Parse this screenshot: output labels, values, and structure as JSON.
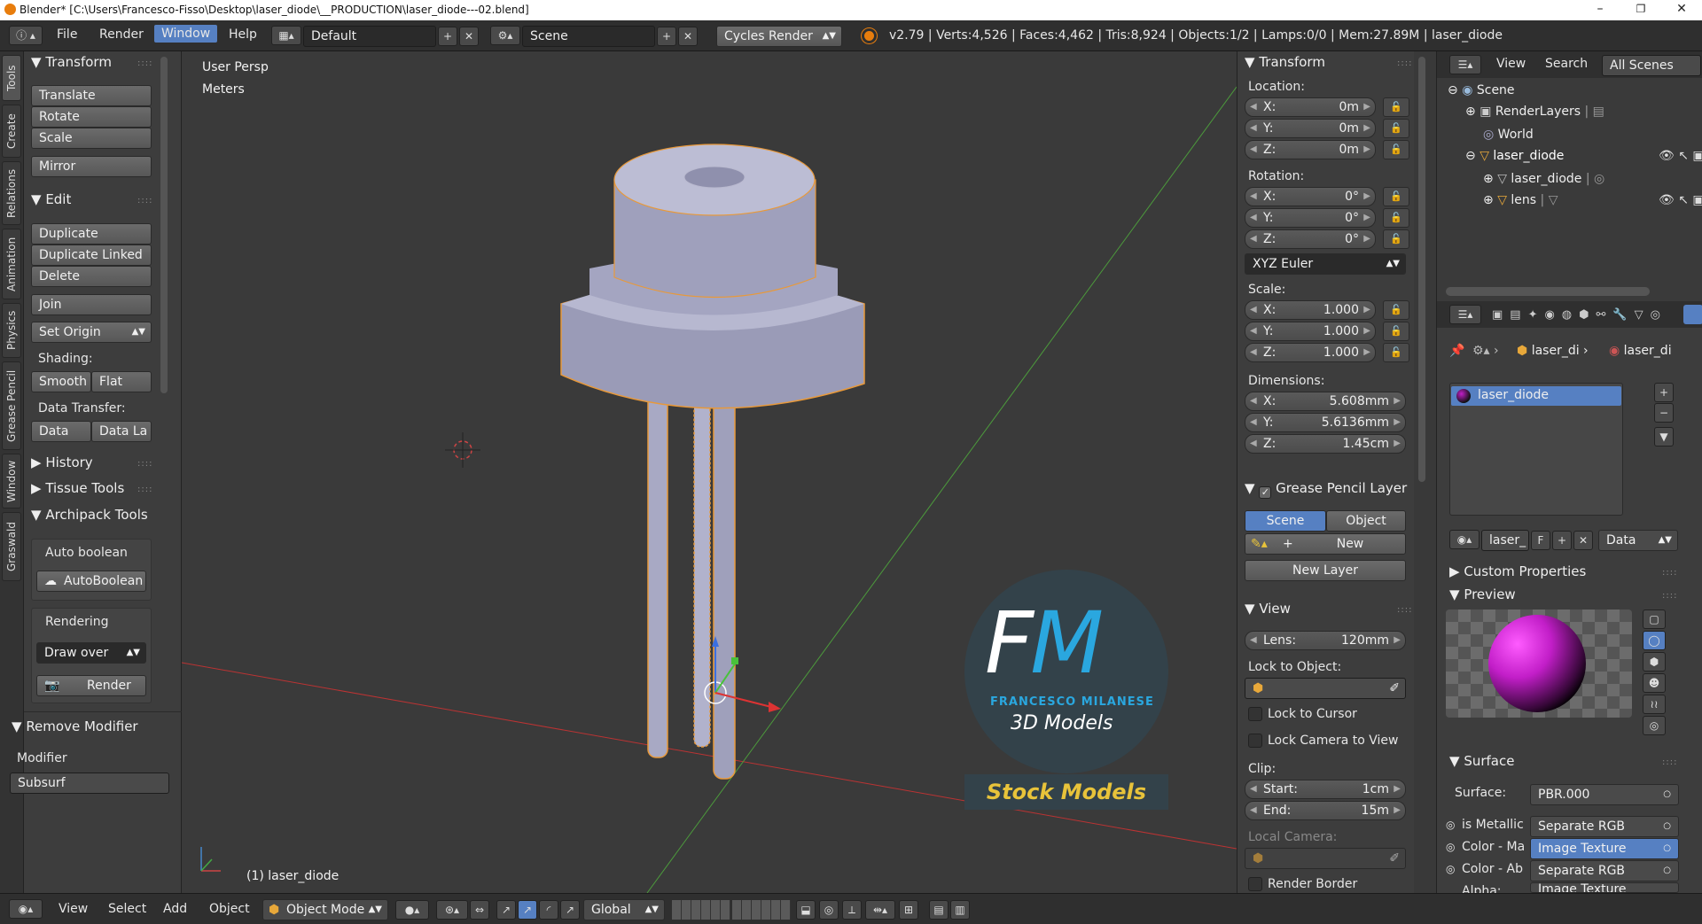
{
  "window": {
    "title": "Blender* [C:\\Users\\Francesco-Fisso\\Desktop\\laser_diode\\__PRODUCTION\\laser_diode---02.blend]",
    "minimize": "–",
    "maximize": "❐",
    "close": "✕"
  },
  "topbar": {
    "menus": [
      "File",
      "Render",
      "Window",
      "Help"
    ],
    "active_menu": "Window",
    "screen_layout": "Default",
    "scene": "Scene",
    "render_engine": "Cycles Render",
    "stats": "v2.79 | Verts:4,526 | Faces:4,462 | Tris:8,924 | Objects:1/2 | Lamps:0/0 | Mem:27.89M | laser_diode"
  },
  "left_tabs": [
    "Tools",
    "Create",
    "Relations",
    "Animation",
    "Physics",
    "Grease Pencil",
    "Window",
    "Graswald"
  ],
  "toolshelf": {
    "transform": {
      "title": "Transform",
      "buttons": [
        "Translate",
        "Rotate",
        "Scale",
        "Mirror"
      ]
    },
    "edit": {
      "title": "Edit",
      "buttons": [
        "Duplicate",
        "Duplicate Linked",
        "Delete",
        "Join"
      ],
      "set_origin": "Set Origin",
      "shading_label": "Shading:",
      "smooth": "Smooth",
      "flat": "Flat",
      "data_transfer_label": "Data Transfer:",
      "data": "Data",
      "data_la": "Data La"
    },
    "history": "History",
    "tissue_tools": "Tissue Tools",
    "archipack": {
      "title": "Archipack Tools",
      "auto_boolean_label": "Auto boolean",
      "autoboolean_btn": "AutoBoolean",
      "rendering_label": "Rendering",
      "draw_over": "Draw over",
      "render_btn": "Render"
    },
    "remove_modifier": {
      "title": "Remove Modifier",
      "modifier_label": "Modifier",
      "modifier_value": "Subsurf"
    }
  },
  "viewport": {
    "view_name": "User Persp",
    "units": "Meters",
    "object_label": "(1) laser_diode",
    "watermark": {
      "initials": "FM",
      "name": "FRANCESCO MILANESE",
      "subtitle": "3D Models",
      "banner": "Stock Models"
    }
  },
  "npanel": {
    "transform_title": "Transform",
    "location_label": "Location:",
    "location": [
      {
        "axis": "X:",
        "value": "0m"
      },
      {
        "axis": "Y:",
        "value": "0m"
      },
      {
        "axis": "Z:",
        "value": "0m"
      }
    ],
    "rotation_label": "Rotation:",
    "rotation": [
      {
        "axis": "X:",
        "value": "0°"
      },
      {
        "axis": "Y:",
        "value": "0°"
      },
      {
        "axis": "Z:",
        "value": "0°"
      }
    ],
    "rotation_mode": "XYZ Euler",
    "scale_label": "Scale:",
    "scale": [
      {
        "axis": "X:",
        "value": "1.000"
      },
      {
        "axis": "Y:",
        "value": "1.000"
      },
      {
        "axis": "Z:",
        "value": "1.000"
      }
    ],
    "dimensions_label": "Dimensions:",
    "dimensions": [
      {
        "axis": "X:",
        "value": "5.608mm"
      },
      {
        "axis": "Y:",
        "value": "5.6136mm"
      },
      {
        "axis": "Z:",
        "value": "1.45cm"
      }
    ],
    "grease_pencil_title": "Grease Pencil Layer",
    "scene_btn": "Scene",
    "object_btn": "Object",
    "new_btn": "New",
    "new_layer_btn": "New Layer",
    "view_title": "View",
    "lens_label": "Lens:",
    "lens_value": "120mm",
    "lock_to_object_label": "Lock to Object:",
    "lock_to_cursor": "Lock to Cursor",
    "lock_camera": "Lock Camera to View",
    "clip_label": "Clip:",
    "clip_start_label": "Start:",
    "clip_start": "1cm",
    "clip_end_label": "End:",
    "clip_end": "15m",
    "local_camera_label": "Local Camera:",
    "render_border": "Render Border"
  },
  "outliner": {
    "view": "View",
    "search": "Search",
    "filter": "All Scenes",
    "items": [
      "Scene",
      "RenderLayers",
      "World",
      "laser_diode",
      "laser_diode",
      "lens"
    ]
  },
  "properties": {
    "breadcrumb": [
      "laser_di",
      "laser_di"
    ],
    "material_slot": "laser_diode",
    "material_name": "laser_",
    "fake_user": "F",
    "link": "Data",
    "custom_properties": "Custom Properties",
    "preview": "Preview",
    "surface_title": "Surface",
    "surface_label": "Surface:",
    "surface_value": "PBR.000",
    "inputs": [
      {
        "label": "is Metallic",
        "value": "Separate RGB"
      },
      {
        "label": "Color - Ma",
        "value": "Image Texture"
      },
      {
        "label": "Color - Ab",
        "value": "Separate RGB"
      },
      {
        "label": "Alpha:",
        "value": "Image Texture"
      }
    ]
  },
  "bottombar": {
    "menus": [
      "View",
      "Select",
      "Add",
      "Object"
    ],
    "mode": "Object Mode",
    "orientation": "Global"
  },
  "colors": {
    "accent": "#5680c2",
    "selection_outline": "#e8993a",
    "object_fill": "#a8a9c4",
    "material_magenta": "#c21ec8"
  }
}
